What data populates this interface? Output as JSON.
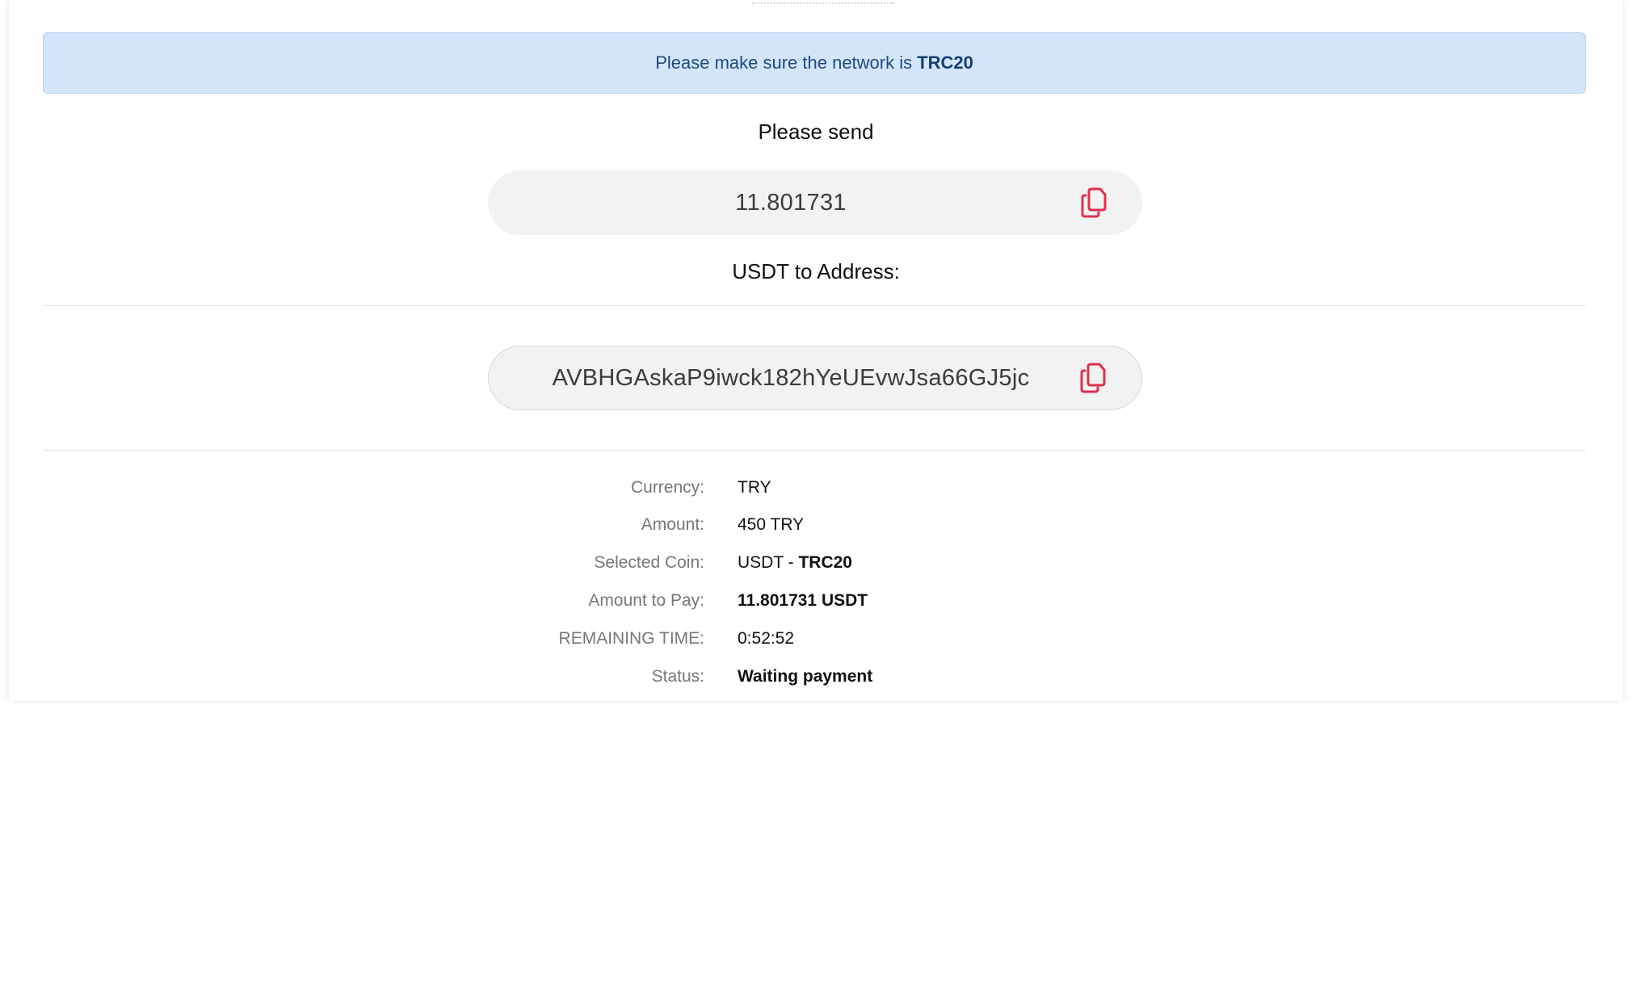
{
  "alert": {
    "text": "Please make sure the network is",
    "network": "TRC20"
  },
  "send": {
    "prompt": "Please send",
    "amount": "11.801731",
    "address_label": "USDT to Address:",
    "address": "AVBHGAskaP9iwck182hYeUEvwJsa66GJ5jc"
  },
  "details": {
    "currency_label": "Currency:",
    "currency_value": "TRY",
    "amount_label": "Amount:",
    "amount_value": "450 TRY",
    "coin_label": "Selected Coin:",
    "coin_value": "USDT - ",
    "coin_network": "TRC20",
    "pay_label": "Amount to Pay:",
    "pay_value": "11.801731 USDT",
    "time_label": "REMAINING TIME:",
    "time_value": "0:52:52",
    "status_label": "Status:",
    "status_value": "Waiting payment"
  },
  "icons": {
    "copy": "copy-icon"
  },
  "colors": {
    "alert_bg": "#d3e5fa",
    "alert_text": "#1f4a80",
    "copy_icon": "#e0304e",
    "status_waiting": "#f5b83a"
  }
}
